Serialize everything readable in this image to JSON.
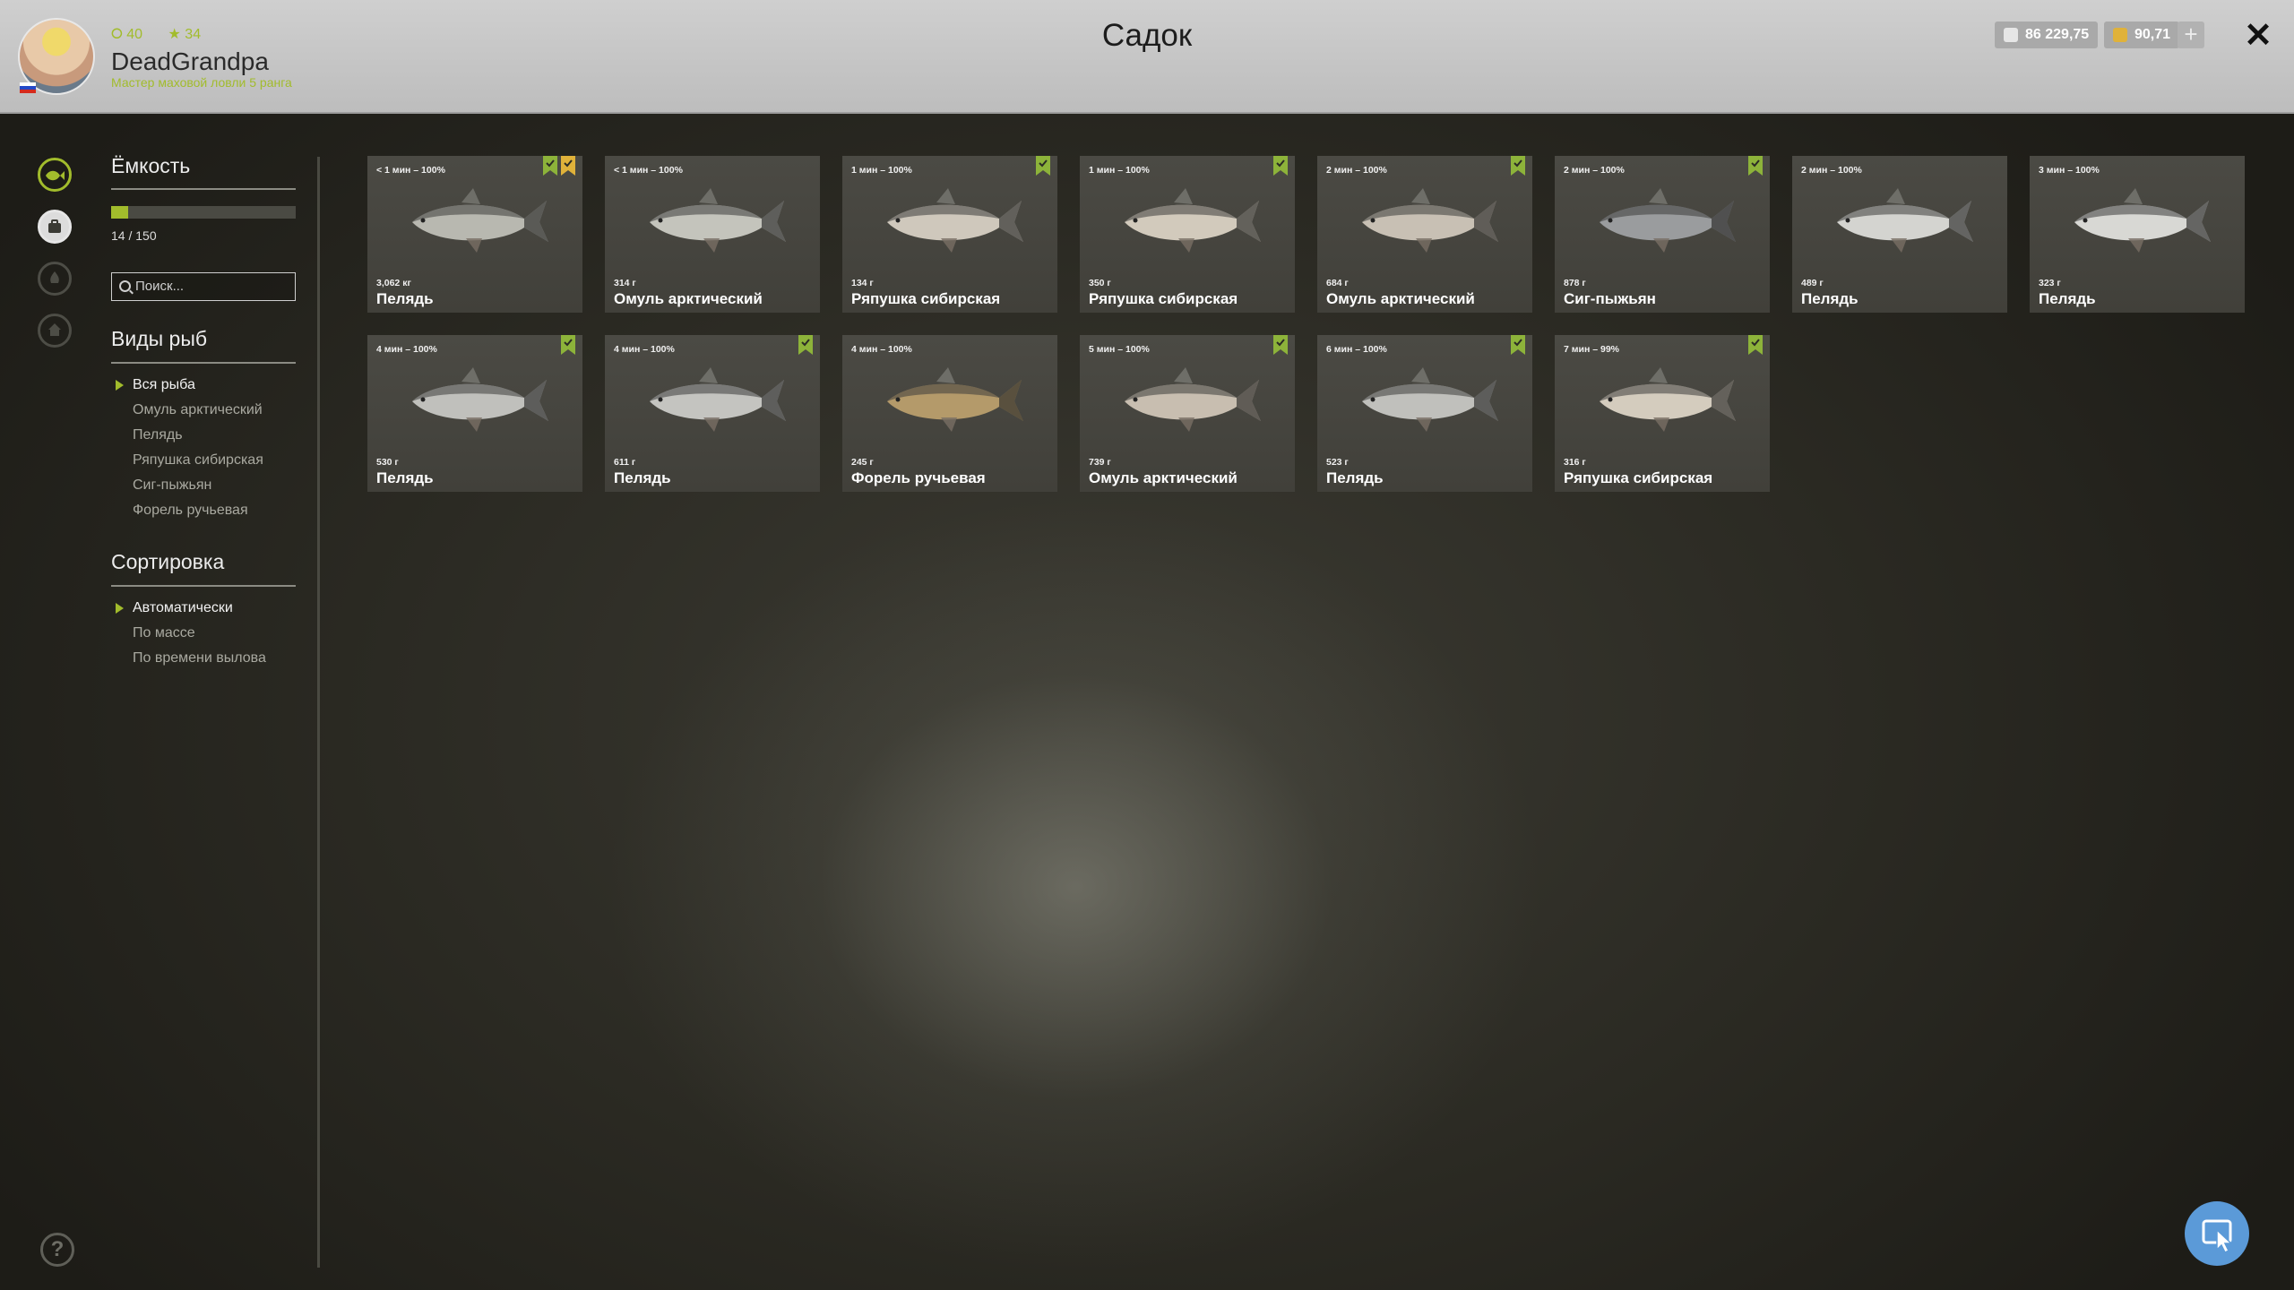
{
  "header": {
    "title": "Садок",
    "username": "DeadGrandpa",
    "level": "40",
    "stars": "34",
    "rank": "Мастер маховой ловли 5 ранга",
    "currency_silver": "86 229,75",
    "currency_gold": "90,71",
    "plus_label": "+",
    "close_label": "✕"
  },
  "sidebar": {
    "capacity_title": "Ёмкость",
    "capacity_text": "14 / 150",
    "capacity_fraction": 0.093,
    "search_placeholder": "Поиск...",
    "species_title": "Виды рыб",
    "species": [
      {
        "label": "Вся рыба",
        "active": true
      },
      {
        "label": "Омуль арктический",
        "active": false
      },
      {
        "label": "Пелядь",
        "active": false
      },
      {
        "label": "Ряпушка сибирская",
        "active": false
      },
      {
        "label": "Сиг-пыжьян",
        "active": false
      },
      {
        "label": "Форель ручьевая",
        "active": false
      }
    ],
    "sort_title": "Сортировка",
    "sort": [
      {
        "label": "Автоматически",
        "active": true
      },
      {
        "label": "По массе",
        "active": false
      },
      {
        "label": "По времени вылова",
        "active": false
      }
    ],
    "help_label": "?"
  },
  "fish": [
    {
      "time": "< 1 мин – 100%",
      "weight": "3,062 кг",
      "name": "Пелядь",
      "badges": [
        "green",
        "gold"
      ],
      "tone": "#b8b8b0"
    },
    {
      "time": "< 1 мин – 100%",
      "weight": "314 г",
      "name": "Омуль арктический",
      "badges": [],
      "tone": "#c4c4bc"
    },
    {
      "time": "1 мин – 100%",
      "weight": "134 г",
      "name": "Ряпушка сибирская",
      "badges": [
        "green"
      ],
      "tone": "#cfc8bc"
    },
    {
      "time": "1 мин – 100%",
      "weight": "350 г",
      "name": "Ряпушка сибирская",
      "badges": [
        "green"
      ],
      "tone": "#d2cabc"
    },
    {
      "time": "2 мин – 100%",
      "weight": "684 г",
      "name": "Омуль арктический",
      "badges": [
        "green"
      ],
      "tone": "#c8c0b4"
    },
    {
      "time": "2 мин – 100%",
      "weight": "878 г",
      "name": "Сиг-пыжьян",
      "badges": [
        "green"
      ],
      "tone": "#9a9c9e"
    },
    {
      "time": "2 мин – 100%",
      "weight": "489 г",
      "name": "Пелядь",
      "badges": [],
      "tone": "#d4d4d0"
    },
    {
      "time": "3 мин – 100%",
      "weight": "323 г",
      "name": "Пелядь",
      "badges": [],
      "tone": "#d8d8d4"
    },
    {
      "time": "4 мин – 100%",
      "weight": "530 г",
      "name": "Пелядь",
      "badges": [
        "green"
      ],
      "tone": "#c0c0bc"
    },
    {
      "time": "4 мин – 100%",
      "weight": "611 г",
      "name": "Пелядь",
      "badges": [
        "green"
      ],
      "tone": "#c4c4c0"
    },
    {
      "time": "4 мин – 100%",
      "weight": "245 г",
      "name": "Форель ручьевая",
      "badges": [],
      "tone": "#b49a6a"
    },
    {
      "time": "5 мин – 100%",
      "weight": "739 г",
      "name": "Омуль арктический",
      "badges": [
        "green"
      ],
      "tone": "#c8beb0"
    },
    {
      "time": "6 мин – 100%",
      "weight": "523 г",
      "name": "Пелядь",
      "badges": [
        "green"
      ],
      "tone": "#c0c0bc"
    },
    {
      "time": "7 мин – 99%",
      "weight": "316 г",
      "name": "Ряпушка сибирская",
      "badges": [
        "green"
      ],
      "tone": "#d4ccbe"
    }
  ],
  "colors": {
    "accent": "#a2bc2c",
    "badge_green": "#8db33a",
    "badge_gold": "#e0b23a",
    "chat_button": "#5b9ad8"
  }
}
